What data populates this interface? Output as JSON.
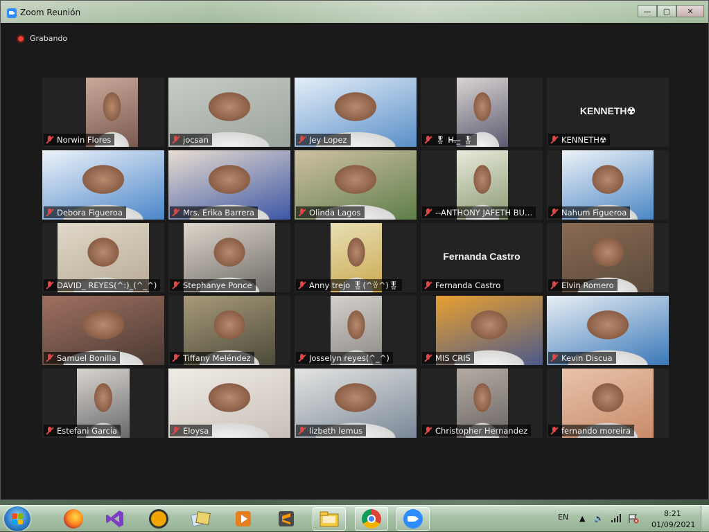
{
  "window": {
    "title": "Zoom Reunión",
    "minimize": "—",
    "maximize": "▢",
    "close": "✕"
  },
  "recording": {
    "label": "Grabando"
  },
  "participants": [
    {
      "name": "Norwin Flores",
      "video": true
    },
    {
      "name": "jocsan",
      "video": true
    },
    {
      "name": "Jey Lopez",
      "video": true
    },
    {
      "name": "🎖 H̶.̶_̶ 🎖",
      "video": true
    },
    {
      "name": "KENNETH☢",
      "video": false,
      "display": "KENNETH☢"
    },
    {
      "name": "Debora Figueroa",
      "video": true
    },
    {
      "name": "Mrs. Erika Barrera",
      "video": true
    },
    {
      "name": "Olinda Lagos",
      "video": true,
      "active": true
    },
    {
      "name": "--ANTHONY JAFETH BU...",
      "video": true
    },
    {
      "name": "Nahum Figueroa",
      "video": true
    },
    {
      "name": "DAVID_ REYES(^:)_(^_^)",
      "video": true
    },
    {
      "name": "Stephanye Ponce",
      "video": true
    },
    {
      "name": "Anny trejo 🎖(^ꈊ^)🎖",
      "video": true
    },
    {
      "name": "Fernanda Castro",
      "video": false,
      "display": "Fernanda Castro"
    },
    {
      "name": "Elvin Romero",
      "video": true
    },
    {
      "name": "Samuel Bonilla",
      "video": true
    },
    {
      "name": "Tiffany Meléndez",
      "video": true
    },
    {
      "name": "Josselyn reyes(^_^)",
      "video": true
    },
    {
      "name": "MIS CRIS",
      "video": true
    },
    {
      "name": "Kevin Discua",
      "video": true
    },
    {
      "name": "Estefani Garcia",
      "video": true
    },
    {
      "name": "Eloysa",
      "video": true
    },
    {
      "name": "lizbeth lemus",
      "video": true
    },
    {
      "name": "Christopher Hernandez",
      "video": true
    },
    {
      "name": "fernando moreira",
      "video": true
    }
  ],
  "taskbar": {
    "apps": [
      "firefox-icon",
      "visual-studio-icon",
      "vpn-icon",
      "folder-photos-icon",
      "media-player-icon",
      "sublime-text-icon",
      "file-explorer-icon",
      "chrome-icon",
      "zoom-icon"
    ],
    "language": "EN",
    "time": "8:21",
    "date": "01/09/2021"
  },
  "colors": {
    "accent_active": "#e8e34a",
    "muted_mic": "#e04646",
    "recording": "#e8412f",
    "zoom_blue": "#2d8cff"
  }
}
